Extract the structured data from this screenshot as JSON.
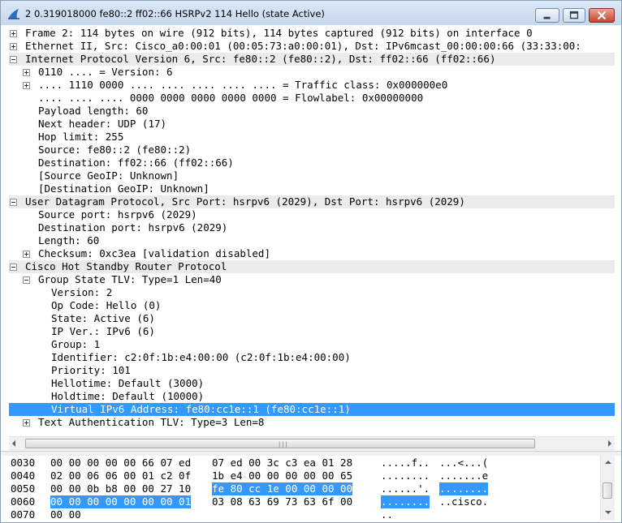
{
  "window": {
    "title": "2 0.319018000 fe80::2 ff02::66 HSRPv2 114 Hello (state Active)"
  },
  "tree": [
    {
      "level": 0,
      "toggle": "plus",
      "hdr": false,
      "text": "Frame 2: 114 bytes on wire (912 bits), 114 bytes captured (912 bits) on interface 0"
    },
    {
      "level": 0,
      "toggle": "plus",
      "hdr": false,
      "text": "Ethernet II, Src: Cisco_a0:00:01 (00:05:73:a0:00:01), Dst: IPv6mcast_00:00:00:66 (33:33:00:"
    },
    {
      "level": 0,
      "toggle": "minus",
      "hdr": true,
      "text": "Internet Protocol Version 6, Src: fe80::2 (fe80::2), Dst: ff02::66 (ff02::66)"
    },
    {
      "level": 1,
      "toggle": "plus",
      "hdr": false,
      "text": "0110 .... = Version: 6"
    },
    {
      "level": 1,
      "toggle": "plus",
      "hdr": false,
      "text": ".... 1110 0000 .... .... .... .... .... = Traffic class: 0x000000e0"
    },
    {
      "level": 1,
      "toggle": "none",
      "hdr": false,
      "text": ".... .... .... 0000 0000 0000 0000 0000 = Flowlabel: 0x00000000"
    },
    {
      "level": 1,
      "toggle": "none",
      "hdr": false,
      "text": "Payload length: 60"
    },
    {
      "level": 1,
      "toggle": "none",
      "hdr": false,
      "text": "Next header: UDP (17)"
    },
    {
      "level": 1,
      "toggle": "none",
      "hdr": false,
      "text": "Hop limit: 255"
    },
    {
      "level": 1,
      "toggle": "none",
      "hdr": false,
      "text": "Source: fe80::2 (fe80::2)"
    },
    {
      "level": 1,
      "toggle": "none",
      "hdr": false,
      "text": "Destination: ff02::66 (ff02::66)"
    },
    {
      "level": 1,
      "toggle": "none",
      "hdr": false,
      "text": "[Source GeoIP: Unknown]"
    },
    {
      "level": 1,
      "toggle": "none",
      "hdr": false,
      "text": "[Destination GeoIP: Unknown]"
    },
    {
      "level": 0,
      "toggle": "minus",
      "hdr": true,
      "text": "User Datagram Protocol, Src Port: hsrpv6 (2029), Dst Port: hsrpv6 (2029)"
    },
    {
      "level": 1,
      "toggle": "none",
      "hdr": false,
      "text": "Source port: hsrpv6 (2029)"
    },
    {
      "level": 1,
      "toggle": "none",
      "hdr": false,
      "text": "Destination port: hsrpv6 (2029)"
    },
    {
      "level": 1,
      "toggle": "none",
      "hdr": false,
      "text": "Length: 60"
    },
    {
      "level": 1,
      "toggle": "plus",
      "hdr": false,
      "text": "Checksum: 0xc3ea [validation disabled]"
    },
    {
      "level": 0,
      "toggle": "minus",
      "hdr": true,
      "text": "Cisco Hot Standby Router Protocol"
    },
    {
      "level": 1,
      "toggle": "minus",
      "hdr": false,
      "text": "Group State TLV: Type=1 Len=40"
    },
    {
      "level": 2,
      "toggle": "none",
      "hdr": false,
      "text": "Version: 2"
    },
    {
      "level": 2,
      "toggle": "none",
      "hdr": false,
      "text": "Op Code: Hello (0)"
    },
    {
      "level": 2,
      "toggle": "none",
      "hdr": false,
      "text": "State: Active (6)"
    },
    {
      "level": 2,
      "toggle": "none",
      "hdr": false,
      "text": "IP Ver.: IPv6 (6)"
    },
    {
      "level": 2,
      "toggle": "none",
      "hdr": false,
      "text": "Group: 1"
    },
    {
      "level": 2,
      "toggle": "none",
      "hdr": false,
      "text": "Identifier: c2:0f:1b:e4:00:00 (c2:0f:1b:e4:00:00)"
    },
    {
      "level": 2,
      "toggle": "none",
      "hdr": false,
      "text": "Priority: 101"
    },
    {
      "level": 2,
      "toggle": "none",
      "hdr": false,
      "text": "Hellotime: Default (3000)"
    },
    {
      "level": 2,
      "toggle": "none",
      "hdr": false,
      "text": "Holdtime: Default (10000)"
    },
    {
      "level": 2,
      "toggle": "none",
      "hdr": false,
      "selected": true,
      "text": "Virtual IPv6 Address: fe80:cc1e::1 (fe80:cc1e::1)"
    },
    {
      "level": 1,
      "toggle": "plus",
      "hdr": false,
      "text": "Text Authentication TLV: Type=3 Len=8"
    }
  ],
  "hex": [
    {
      "offset": "0030",
      "b1": "00 00 00 00 00 66 07 ed",
      "b2": "07 ed 00 3c c3 ea 01 28",
      "a1": ".....f..",
      "a2": "...<...(",
      "hb1": false,
      "hb2": false,
      "ha1": false,
      "ha2": false
    },
    {
      "offset": "0040",
      "b1": "02 00 06 06 00 01 c2 0f",
      "b2": "1b e4 00 00 00 00 00 65",
      "a1": "........",
      "a2": ".......e",
      "hb1": false,
      "hb2": false,
      "ha1": false,
      "ha2": false
    },
    {
      "offset": "0050",
      "b1": "00 00 0b b8 00 00 27 10",
      "b2": "fe 80 cc 1e 00 00 00 00",
      "a1": "......'.",
      "a2": "........",
      "hb1": false,
      "hb2": true,
      "ha1": false,
      "ha2": true
    },
    {
      "offset": "0060",
      "b1": "00 00 00 00 00 00 00 01",
      "b2": "03 08 63 69 73 63 6f 00",
      "a1": "........",
      "a2": "..cisco.",
      "hb1": true,
      "hb2": false,
      "ha1": true,
      "ha2": false
    },
    {
      "offset": "0070",
      "b1": "00 00",
      "b2": "",
      "a1": "..",
      "a2": "",
      "hb1": false,
      "hb2": false,
      "ha1": false,
      "ha2": false
    }
  ],
  "colors": {
    "selection": "#3399ff",
    "header_row": "#ebebeb"
  },
  "icons": {
    "app": "wireshark-fin-icon",
    "minimize": "minimize-icon",
    "maximize": "maximize-icon",
    "close": "close-icon"
  }
}
